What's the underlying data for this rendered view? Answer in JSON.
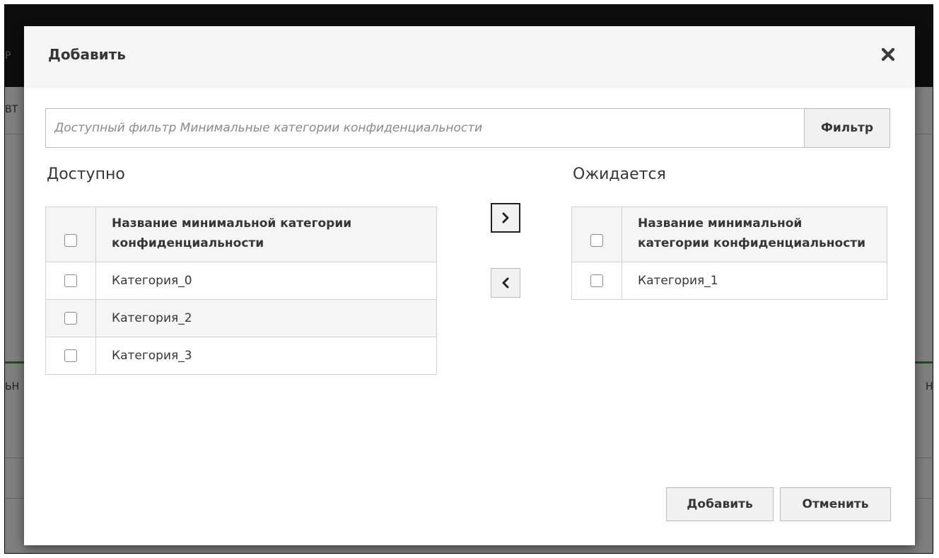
{
  "background": {
    "fragments": [
      "Р",
      "ВТ",
      "ЬН",
      "Н"
    ]
  },
  "modal": {
    "title": "Добавить",
    "close_icon": "close-x-icon",
    "filter": {
      "placeholder": "Доступный фильтр Минимальные категории конфиденциальности",
      "value": "",
      "button_label": "Фильтр"
    },
    "available": {
      "title": "Доступно",
      "header": "Название минимальной категории конфиденциальности",
      "rows": [
        "Категория_0",
        "Категория_2",
        "Категория_3"
      ]
    },
    "expected": {
      "title": "Ожидается",
      "header": "Название минимальной категории конфиденциальности",
      "rows": [
        "Категория_1"
      ]
    },
    "move_right_icon": "chevron-right-icon",
    "move_left_icon": "chevron-left-icon",
    "footer": {
      "add_label": "Добавить",
      "cancel_label": "Отменить"
    }
  }
}
